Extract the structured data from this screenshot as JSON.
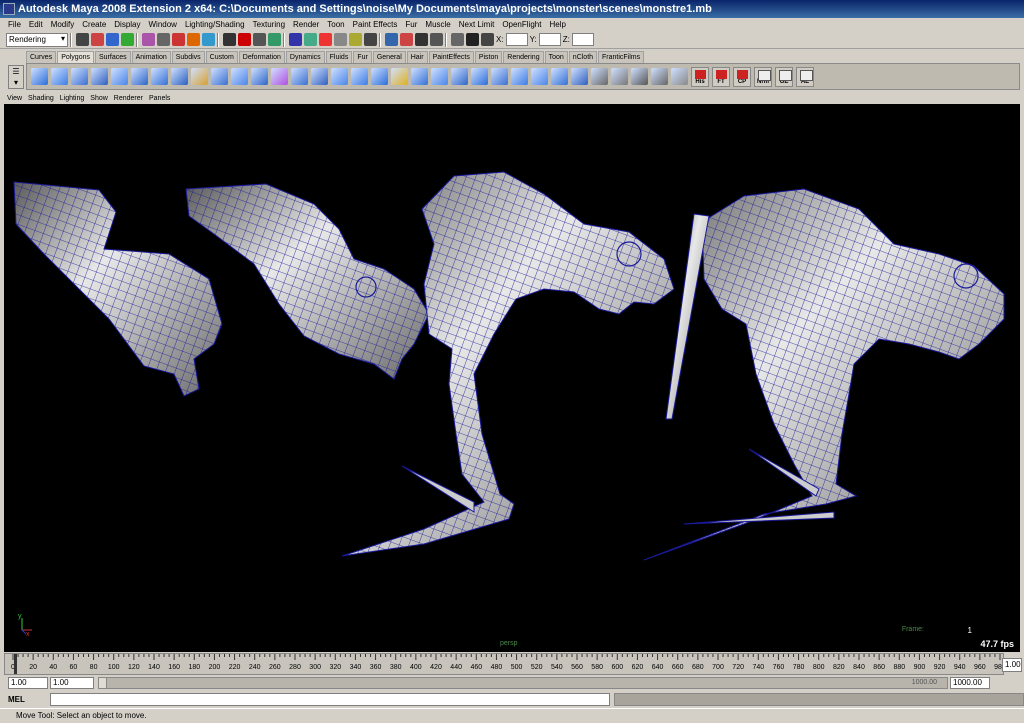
{
  "window": {
    "title": "Autodesk Maya 2008 Extension 2 x64: C:\\Documents and Settings\\noise\\My Documents\\maya\\projects\\monster\\scenes\\monstre1.mb"
  },
  "menubar": [
    "File",
    "Edit",
    "Modify",
    "Create",
    "Display",
    "Window",
    "Lighting/Shading",
    "Texturing",
    "Render",
    "Toon",
    "Paint Effects",
    "Fur",
    "Muscle",
    "Next Limit",
    "OpenFlight",
    "Help"
  ],
  "status_line": {
    "mode": "Rendering",
    "x_label": "X:",
    "y_label": "Y:",
    "z_label": "Z:"
  },
  "shelf": {
    "tabs": [
      "Curves",
      "Polygons",
      "Surfaces",
      "Animation",
      "Subdivs",
      "Custom",
      "Deformation",
      "Dynamics",
      "Fluids",
      "Fur",
      "General",
      "Hair",
      "PaintEffects",
      "Piston",
      "Rendering",
      "Toon",
      "nCloth",
      "FranticFilms"
    ],
    "active_tab": "Polygons",
    "labeled_buttons": [
      "His",
      "FT",
      "CP",
      "Nrm",
      "GE",
      "AE"
    ]
  },
  "panel_menu": [
    "View",
    "Shading",
    "Lighting",
    "Show",
    "Renderer",
    "Panels"
  ],
  "viewport": {
    "camera": "persp",
    "frame_label": "Frame:",
    "frame_value": "1",
    "fps": "47.7 fps"
  },
  "timeline": {
    "ticks": [
      "0",
      "20",
      "40",
      "60",
      "80",
      "100",
      "120",
      "140",
      "160",
      "180",
      "200",
      "220",
      "240",
      "260",
      "280",
      "300",
      "320",
      "340",
      "360",
      "380",
      "400",
      "420",
      "440",
      "460",
      "480",
      "500",
      "520",
      "540",
      "560",
      "580",
      "600",
      "620",
      "640",
      "660",
      "680",
      "700",
      "720",
      "740",
      "760",
      "780",
      "800",
      "820",
      "840",
      "860",
      "880",
      "900",
      "920",
      "940",
      "960",
      "980"
    ],
    "current_frame": "1.00"
  },
  "range": {
    "start": "1.00",
    "playback_start": "1.00",
    "playback_end": "1000.00",
    "end": "1000.00"
  },
  "command_line": {
    "label": "MEL"
  },
  "help_line": {
    "text": "Move Tool: Select an object to move."
  },
  "colors": {
    "viewport_bg": "#000000",
    "wire": "#1a1a9a",
    "mesh_light": "#e8e8e8",
    "mesh_dark": "#5a5a5a"
  }
}
